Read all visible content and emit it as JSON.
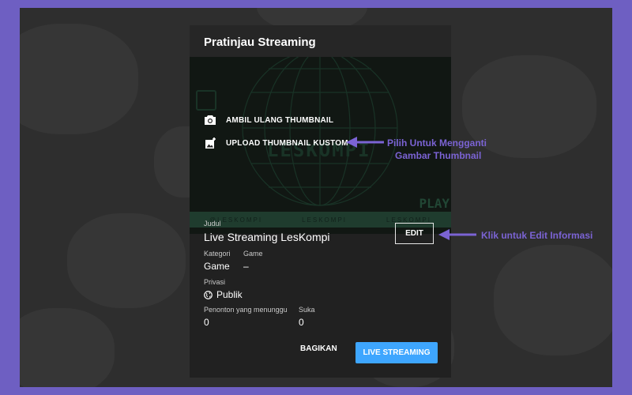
{
  "dialog": {
    "title": "Pratinjau Streaming",
    "thumbnail": {
      "brand_text": "LESKOMPI",
      "play_text": "PLAY",
      "strip_items": [
        "@LESKOMPI",
        "LESKOMPI",
        "LESKOMPI"
      ]
    },
    "actions": {
      "retake_label": "AMBIL ULANG THUMBNAIL",
      "upload_label": "UPLOAD THUMBNAIL KUSTOM"
    },
    "title_label": "Judul",
    "title_value": "Live Streaming LesKompi",
    "edit_label": "EDIT",
    "category_label": "Kategori",
    "category_value": "Game",
    "game_label": "Game",
    "game_value": "–",
    "privacy_label": "Privasi",
    "privacy_value": "Publik",
    "waiting_label": "Penonton yang menunggu",
    "waiting_value": "0",
    "likes_label": "Suka",
    "likes_value": "0",
    "share_label": "BAGIKAN",
    "live_label": "LIVE STREAMING"
  },
  "annotations": {
    "thumbnail_line1": "Pilih Untuk Mengganti",
    "thumbnail_line2": "Gambar Thumbnail",
    "edit_note": "Klik untuk Edit Informasi"
  },
  "colors": {
    "frame": "#6e5fc2",
    "annotation": "#7b63d4",
    "live_button": "#3ea6ff",
    "dialog_bg": "#212121"
  },
  "icons": [
    "camera-icon",
    "add-photo-icon",
    "globe-icon"
  ]
}
